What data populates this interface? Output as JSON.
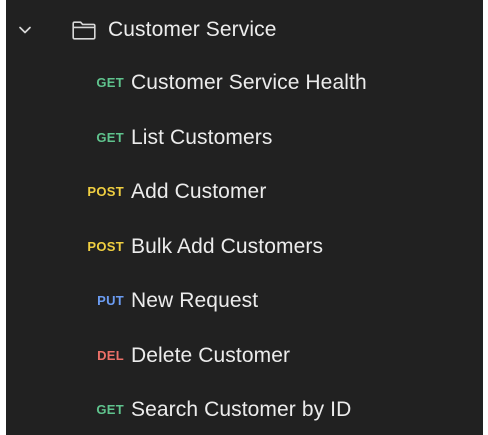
{
  "folder": {
    "name": "Customer Service",
    "expanded": true,
    "chevron_icon": "chevron-down-icon",
    "folder_icon": "folder-outline-icon",
    "text_color": "#ececec",
    "background": "#212121"
  },
  "method_colors": {
    "GET": "#5fc38d",
    "POST": "#f0cf41",
    "PUT": "#6b9cf2",
    "DEL": "#ec7068"
  },
  "requests": [
    {
      "method": "GET",
      "name": "Customer Service Health"
    },
    {
      "method": "GET",
      "name": "List Customers"
    },
    {
      "method": "POST",
      "name": "Add Customer"
    },
    {
      "method": "POST",
      "name": "Bulk Add Customers"
    },
    {
      "method": "PUT",
      "name": "New Request"
    },
    {
      "method": "DEL",
      "name": "Delete Customer"
    },
    {
      "method": "GET",
      "name": "Search Customer by ID"
    }
  ]
}
